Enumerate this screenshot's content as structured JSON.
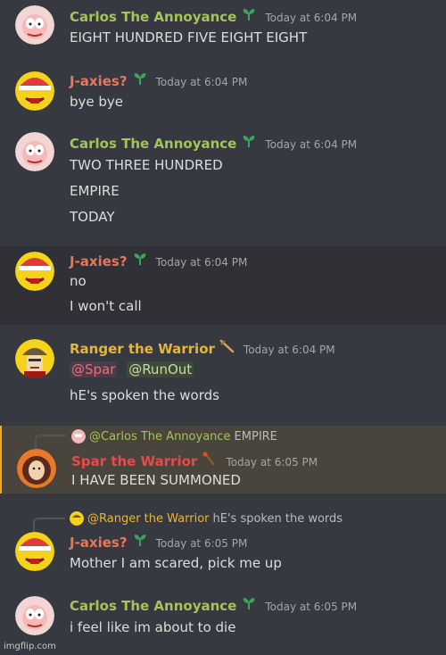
{
  "messages": [
    {
      "author": "Carlos The Annoyance",
      "author_color": "#a8c25a",
      "time": "Today at 6:04 PM",
      "lines": [
        "EIGHT HUNDRED FIVE EIGHT EIGHT"
      ]
    },
    {
      "author": "J-axies?",
      "author_color": "#e8765a",
      "time": "Today at 6:04 PM",
      "lines": [
        "bye bye"
      ]
    },
    {
      "author": "Carlos The Annoyance",
      "author_color": "#a8c25a",
      "time": "Today at 6:04 PM",
      "lines": [
        "TWO THREE HUNDRED",
        "EMPIRE",
        "TODAY"
      ]
    },
    {
      "author": "J-axies?",
      "author_color": "#e8765a",
      "time": "Today at 6:04 PM",
      "lines": [
        "no",
        "I won't call"
      ]
    },
    {
      "author": "Ranger the Warrior",
      "author_color": "#e8b53c",
      "time": "Today at 6:04 PM",
      "mentions": [
        "@Spar",
        "@RunOut"
      ],
      "lines": [
        "hE's spoken the words"
      ]
    },
    {
      "reply": {
        "to": "@Carlos The Annoyance",
        "text": "EMPIRE"
      },
      "author": "Spar the Warrior",
      "author_color": "#e84a4a",
      "time": "Today at 6:05 PM",
      "lines": [
        "I HAVE BEEN SUMMONED"
      ]
    },
    {
      "reply": {
        "to": "@Ranger the Warrior",
        "text": "hE's spoken the words"
      },
      "author": "J-axies?",
      "author_color": "#e8765a",
      "time": "Today at 6:05 PM",
      "lines": [
        "Mother I am scared, pick me up"
      ]
    },
    {
      "author": "Carlos The Annoyance",
      "author_color": "#a8c25a",
      "time": "Today at 6:05 PM",
      "lines": [
        "i feel like im about to die"
      ]
    }
  ],
  "icons": {
    "sprout": "sprout-badge-icon",
    "sword": "sword-badge-icon",
    "torch": "torch-badge-icon"
  },
  "watermark": "imgflip.com"
}
